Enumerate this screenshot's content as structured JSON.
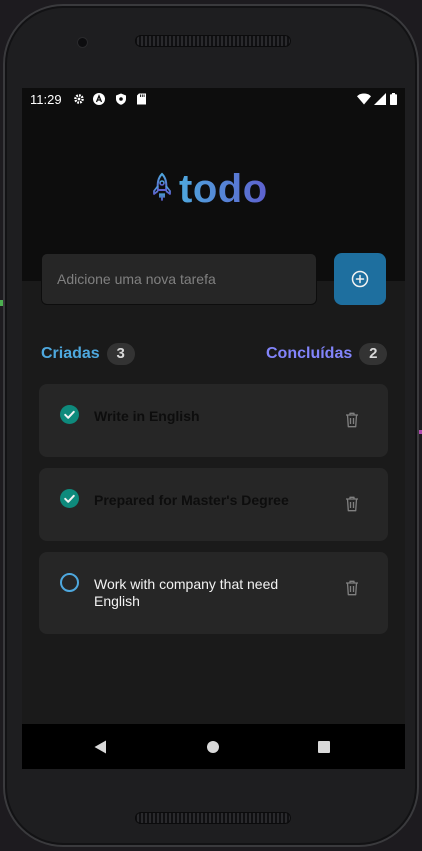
{
  "status_bar": {
    "time": "11:29",
    "icons": [
      "settings-icon",
      "a-badge-icon",
      "shield-icon",
      "sd-card-icon",
      "wifi-icon",
      "signal-icon",
      "battery-icon"
    ]
  },
  "header": {
    "logo_icon": "rocket-icon",
    "logo_text": "todo"
  },
  "new_task": {
    "placeholder": "Adicione uma nova tarefa",
    "add_icon": "plus-circle-icon"
  },
  "summary": {
    "created_label": "Criadas",
    "created_count": "3",
    "done_label": "Concluídas",
    "done_count": "2"
  },
  "tasks": [
    {
      "text": "Write in English",
      "completed": true
    },
    {
      "text": "Prepared for Master's Degree",
      "completed": true
    },
    {
      "text": "Work with company that need English",
      "completed": false
    }
  ],
  "colors": {
    "blue": "#4ea8de",
    "purple": "#8284fa",
    "button": "#1e6f9f",
    "check_done": "#0e8a7c",
    "card": "#262626"
  }
}
